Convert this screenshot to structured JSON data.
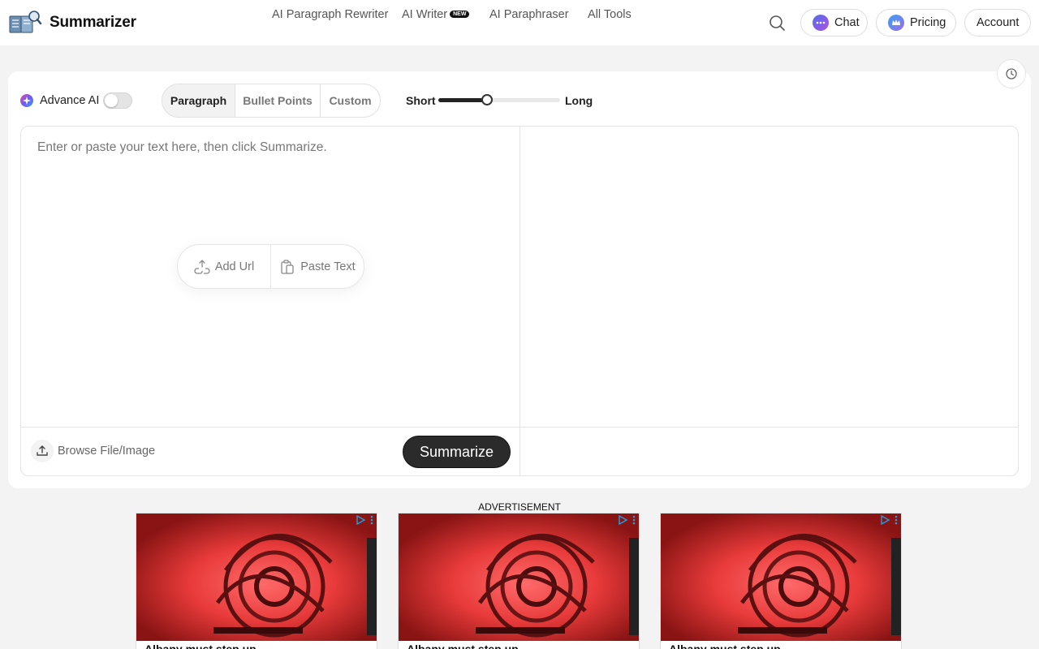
{
  "header": {
    "brand": "Summarizer",
    "nav": [
      {
        "label": "AI Paragraph Rewriter"
      },
      {
        "label": "AI Writer",
        "badge": "NEW"
      },
      {
        "label": "AI Paraphraser"
      },
      {
        "label": "All Tools"
      }
    ],
    "chat_label": "Chat",
    "pricing_label": "Pricing",
    "account_label": "Account"
  },
  "controls": {
    "advance_ai_label": "Advance AI",
    "advance_ai_enabled": false,
    "modes": [
      "Paragraph",
      "Bullet Points",
      "Custom"
    ],
    "active_mode": "Paragraph",
    "length_short_label": "Short",
    "length_long_label": "Long",
    "length_value_percent": 40
  },
  "editor": {
    "placeholder": "Enter or paste your text here, then click Summarize.",
    "value": "",
    "add_url_label": "Add Url",
    "paste_text_label": "Paste Text",
    "browse_label": "Browse File/Image",
    "summarize_label": "Summarize"
  },
  "ads": {
    "label": "ADVERTISEMENT",
    "items": [
      {
        "headline": "Albany must step up"
      },
      {
        "headline": "Albany must step up"
      },
      {
        "headline": "Albany must step up"
      }
    ]
  },
  "colors": {
    "accent_dark": "#2b2b2b",
    "chat_icon": "#7b5cf0",
    "pricing_icon": "#3aa0f0"
  }
}
